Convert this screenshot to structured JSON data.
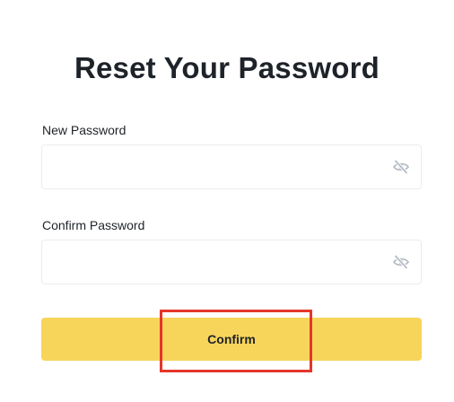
{
  "form": {
    "title": "Reset Your Password",
    "new_password": {
      "label": "New Password",
      "value": "",
      "placeholder": "",
      "toggle_icon": "eye-slash-icon"
    },
    "confirm_password": {
      "label": "Confirm Password",
      "value": "",
      "placeholder": "",
      "toggle_icon": "eye-slash-icon"
    },
    "submit_label": "Confirm"
  },
  "colors": {
    "button": "#f7d55b",
    "text": "#1e2329",
    "field_border": "#eaecef",
    "highlight": "#e5362a"
  }
}
